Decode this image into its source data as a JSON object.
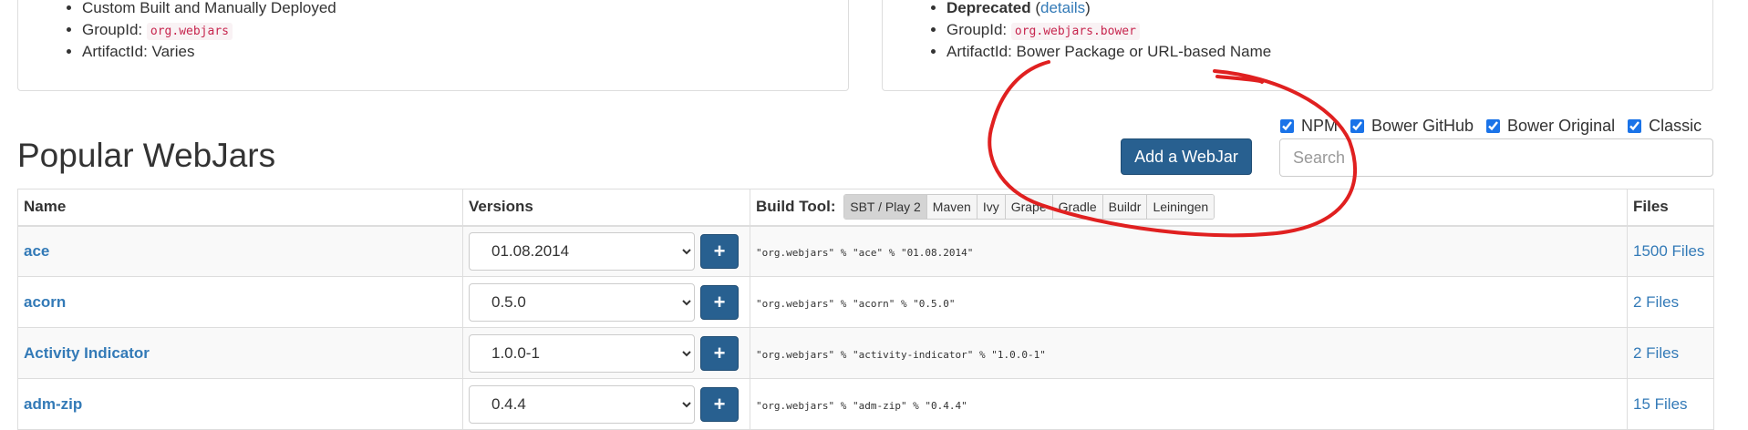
{
  "panels": {
    "left": {
      "items": [
        {
          "text": "Custom Built and Manually Deployed"
        },
        {
          "label": "GroupId:",
          "code": "org.webjars"
        },
        {
          "text": "ArtifactId: Varies"
        }
      ]
    },
    "right": {
      "deprecated_label": "Deprecated",
      "details_open": "(",
      "details_link": "details",
      "details_close": ")",
      "groupid_label": "GroupId:",
      "groupid_code": "org.webjars.bower",
      "artifact_text": "ArtifactId: Bower Package or URL-based Name"
    }
  },
  "page_title": "Popular WebJars",
  "add_button": "Add a WebJar",
  "filters": [
    "NPM",
    "Bower GitHub",
    "Bower Original",
    "Classic"
  ],
  "search": {
    "placeholder": "Search"
  },
  "table": {
    "headers": {
      "name": "Name",
      "versions": "Versions",
      "build_tool": "Build Tool:",
      "files": "Files"
    },
    "build_tools": [
      "SBT / Play 2",
      "Maven",
      "Ivy",
      "Grape",
      "Gradle",
      "Buildr",
      "Leiningen"
    ],
    "rows": [
      {
        "name": "ace",
        "version": "01.08.2014",
        "dependency": "\"org.webjars\" % \"ace\" % \"01.08.2014\"",
        "files": "1500 Files"
      },
      {
        "name": "acorn",
        "version": "0.5.0",
        "dependency": "\"org.webjars\" % \"acorn\" % \"0.5.0\"",
        "files": "2 Files"
      },
      {
        "name": "Activity Indicator",
        "version": "1.0.0-1",
        "dependency": "\"org.webjars\" % \"activity-indicator\" % \"1.0.0-1\"",
        "files": "2 Files"
      },
      {
        "name": "adm-zip",
        "version": "0.4.4",
        "dependency": "\"org.webjars\" % \"adm-zip\" % \"0.4.4\"",
        "files": "15 Files"
      }
    ]
  },
  "annotation_color": "#e02020"
}
